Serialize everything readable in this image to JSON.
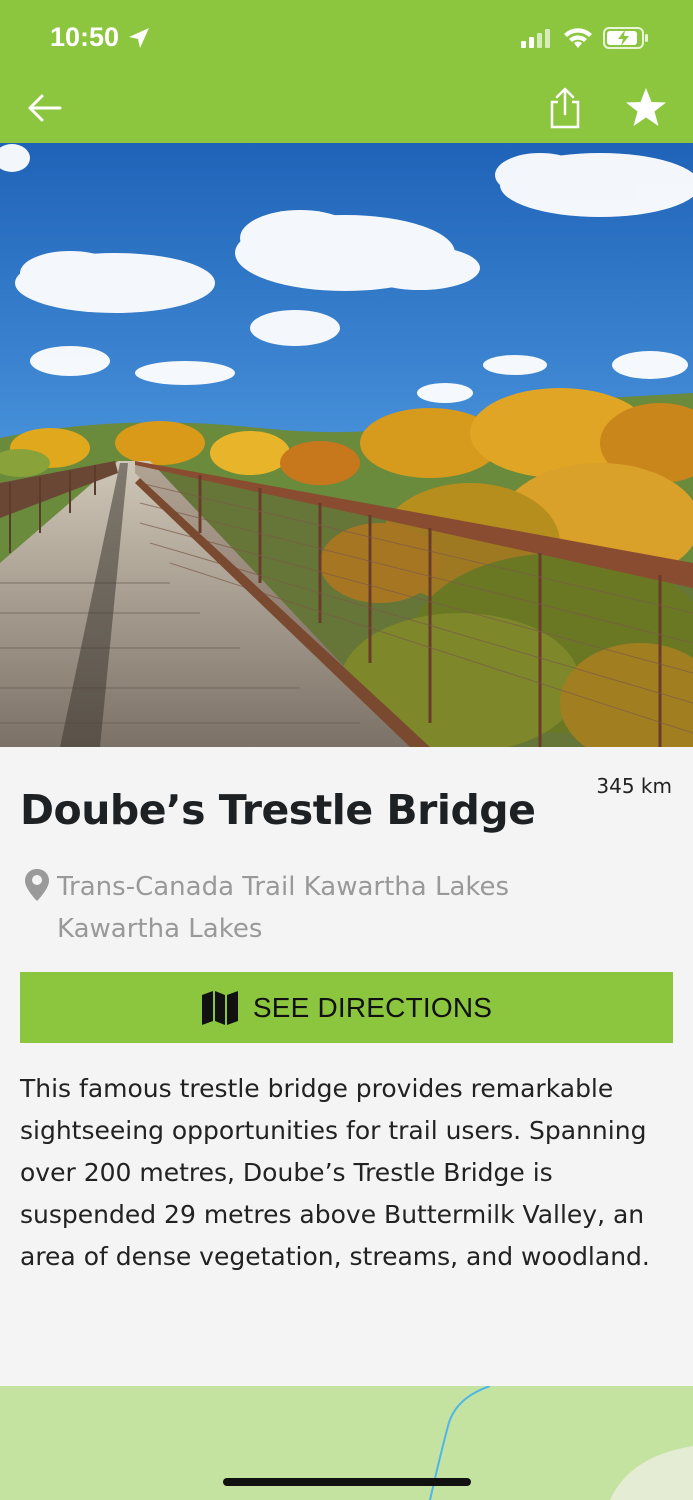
{
  "status_bar": {
    "time": "10:50"
  },
  "detail": {
    "distance": "345 km",
    "title": "Doube’s Trestle Bridge",
    "location_line1": "Trans-Canada Trail Kawartha Lakes",
    "location_line2": "Kawartha Lakes",
    "directions_label": "SEE DIRECTIONS",
    "description": "This famous trestle bridge provides remarkable sightseeing opportunities for trail users. Spanning over 200 metres, Doube’s Trestle Bridge is suspended 29 metres above Buttermilk Valley, an area of dense vegetation, streams, and woodland."
  },
  "colors": {
    "accent": "#8cc63f",
    "map_green": "#c4e3a1"
  },
  "icons": [
    "location-arrow-icon",
    "signal-icon",
    "wifi-icon",
    "battery-icon",
    "back-arrow-icon",
    "share-icon",
    "star-icon",
    "location-pin-icon",
    "map-icon"
  ]
}
